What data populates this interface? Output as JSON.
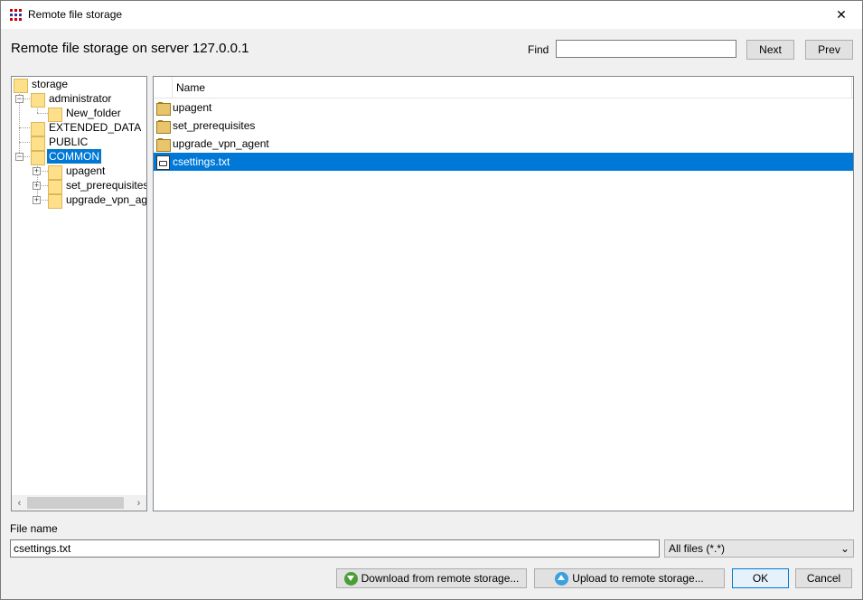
{
  "window": {
    "title": "Remote file storage",
    "close_glyph": "✕"
  },
  "header": {
    "title": "Remote file storage on server 127.0.0.1"
  },
  "find": {
    "label": "Find",
    "value": "",
    "next_label": "Next",
    "prev_label": "Prev"
  },
  "tree": {
    "root": "storage",
    "items": [
      {
        "label": "administrator",
        "expander": "−"
      },
      {
        "label": "New_folder"
      },
      {
        "label": "EXTENDED_DATA"
      },
      {
        "label": "PUBLIC"
      },
      {
        "label": "COMMON",
        "expander": "−",
        "selected": true
      },
      {
        "label": "upagent",
        "expander": "+"
      },
      {
        "label": "set_prerequisites",
        "expander": "+"
      },
      {
        "label": "upgrade_vpn_agent",
        "expander": "+"
      }
    ],
    "scroll_left": "‹",
    "scroll_right": "›"
  },
  "list": {
    "column_name": "Name",
    "rows": [
      {
        "name": "upagent",
        "icon": "folder-icon"
      },
      {
        "name": "set_prerequisites",
        "icon": "folder-icon"
      },
      {
        "name": "upgrade_vpn_agent",
        "icon": "folder-icon"
      },
      {
        "name": "csettings.txt",
        "icon": "file-icon",
        "selected": true
      }
    ]
  },
  "file_name": {
    "label": "File name",
    "value": "csettings.txt"
  },
  "filter": {
    "value": "All files (*.*)",
    "chevron": "⌄"
  },
  "buttons": {
    "download": "Download from remote storage...",
    "upload": "Upload to remote storage...",
    "ok": "OK",
    "cancel": "Cancel"
  },
  "colors": {
    "selection": "#0078d7",
    "folder": "#ffe08a"
  }
}
